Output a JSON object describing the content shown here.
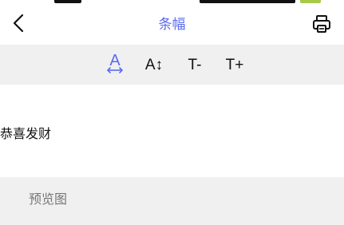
{
  "nav": {
    "title": "条幅",
    "title_color": "#5b6bf0",
    "back_icon": "chevron-left-icon",
    "print_icon": "printer-icon"
  },
  "toolbar": {
    "tools": [
      {
        "name": "text-width",
        "glyph": "A",
        "color": "#5b6bf0",
        "active": true
      },
      {
        "name": "text-height",
        "glyph": "A↕",
        "color": "#111111",
        "active": false
      },
      {
        "name": "text-size-decrease",
        "glyph": "T-",
        "color": "#111111",
        "active": false
      },
      {
        "name": "text-size-increase",
        "glyph": "T+",
        "color": "#111111",
        "active": false
      }
    ]
  },
  "content": {
    "banner_text": "恭喜发财"
  },
  "preview": {
    "label": "预览图"
  }
}
